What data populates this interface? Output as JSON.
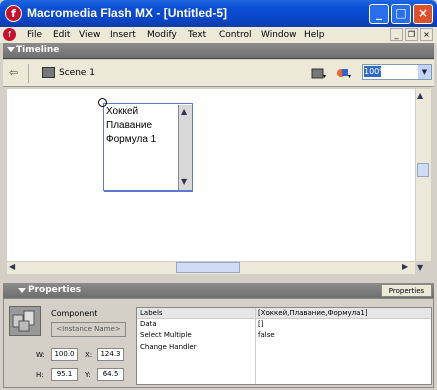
{
  "window": {
    "title": "Macromedia Flash MX - [Untitled-5]",
    "minimize": "_",
    "maximize": "□",
    "close": "×"
  },
  "menu": [
    "File",
    "Edit",
    "View",
    "Insert",
    "Modify",
    "Text",
    "Control",
    "Window",
    "Help"
  ],
  "mdi_controls": {
    "minimize": "_",
    "restore": "❐",
    "close": "×"
  },
  "timeline": {
    "label": "Timeline"
  },
  "scene": {
    "label": "Scene 1",
    "zoom": "100%"
  },
  "listbox": {
    "items": [
      "Хоккей",
      "Плавание",
      "Формула 1"
    ]
  },
  "properties": {
    "title": "Properties",
    "tab": "Properties",
    "type": "Component",
    "instance_placeholder": "<Instance Name>",
    "w_label": "W:",
    "w_value": "100.0",
    "x_label": "X:",
    "x_value": "124.3",
    "h_label": "H:",
    "h_value": "95.1",
    "y_label": "Y:",
    "y_value": "64.5",
    "params": [
      {
        "name": "Labels",
        "value": "[Хоккей,Плавание,Формула1]"
      },
      {
        "name": "Data",
        "value": "[]"
      },
      {
        "name": "Select Multiple",
        "value": "false"
      },
      {
        "name": "Change Handler",
        "value": ""
      }
    ]
  }
}
